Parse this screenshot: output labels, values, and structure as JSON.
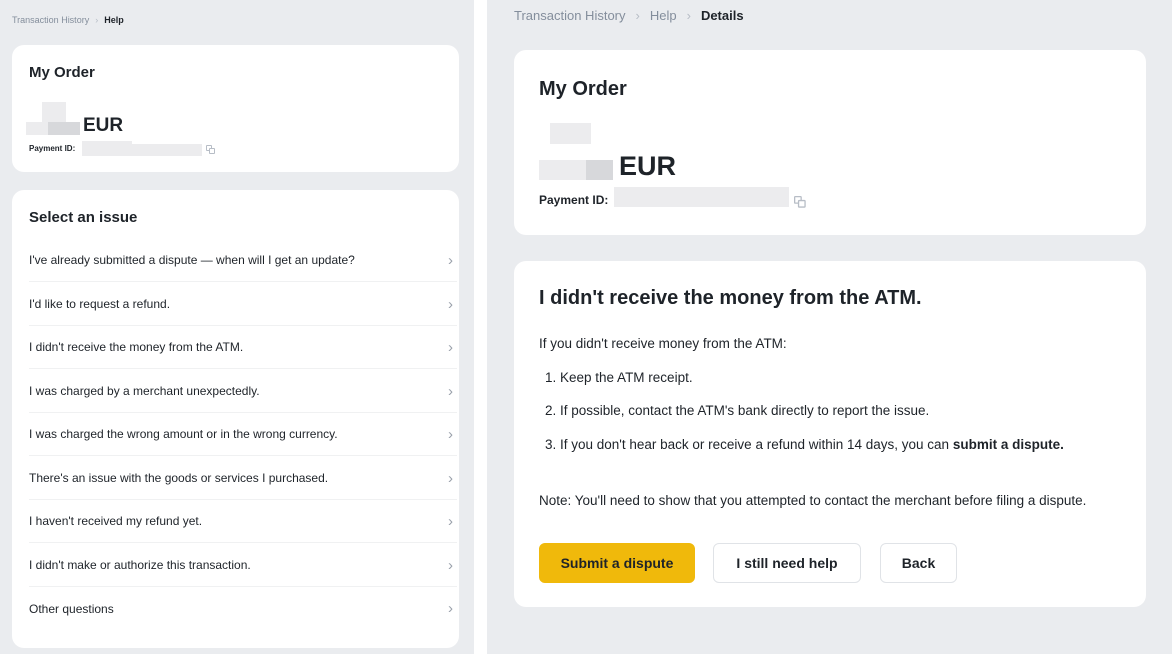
{
  "left": {
    "breadcrumb": [
      "Transaction History",
      "Help"
    ],
    "order": {
      "title": "My Order",
      "currency": "EUR",
      "payment_id_label": "Payment ID:"
    },
    "issues_title": "Select an issue",
    "issues": [
      "I've already submitted a dispute — when will I get an update?",
      "I'd like to request a refund.",
      "I didn't receive the money from the ATM.",
      "I was charged by a merchant unexpectedly.",
      "I was charged the wrong amount or in the wrong currency.",
      "There's an issue with the goods or services I purchased.",
      "I haven't received my refund yet.",
      "I didn't make or authorize this transaction.",
      "Other questions"
    ]
  },
  "right": {
    "breadcrumb": [
      "Transaction History",
      "Help",
      "Details"
    ],
    "order": {
      "title": "My Order",
      "currency": "EUR",
      "payment_id_label": "Payment ID:"
    },
    "detail": {
      "heading": "I didn't receive the money from the ATM.",
      "intro": "If you didn't receive money from the ATM:",
      "steps": [
        "1. Keep the ATM receipt.",
        "2. If possible, contact the ATM's bank directly to report the issue.",
        "3. If you don't hear back or receive a refund within 14 days, you can "
      ],
      "step3_link": "submit a dispute.",
      "note": "Note: You'll need to show that you attempted to contact the merchant before filing a dispute."
    },
    "buttons": {
      "submit": "Submit a dispute",
      "help": "I still need help",
      "back": "Back"
    }
  },
  "colors": {
    "accent": "#f0b90b",
    "page_bg": "#eaecef",
    "text": "#1e2329",
    "muted": "#848e9c"
  }
}
